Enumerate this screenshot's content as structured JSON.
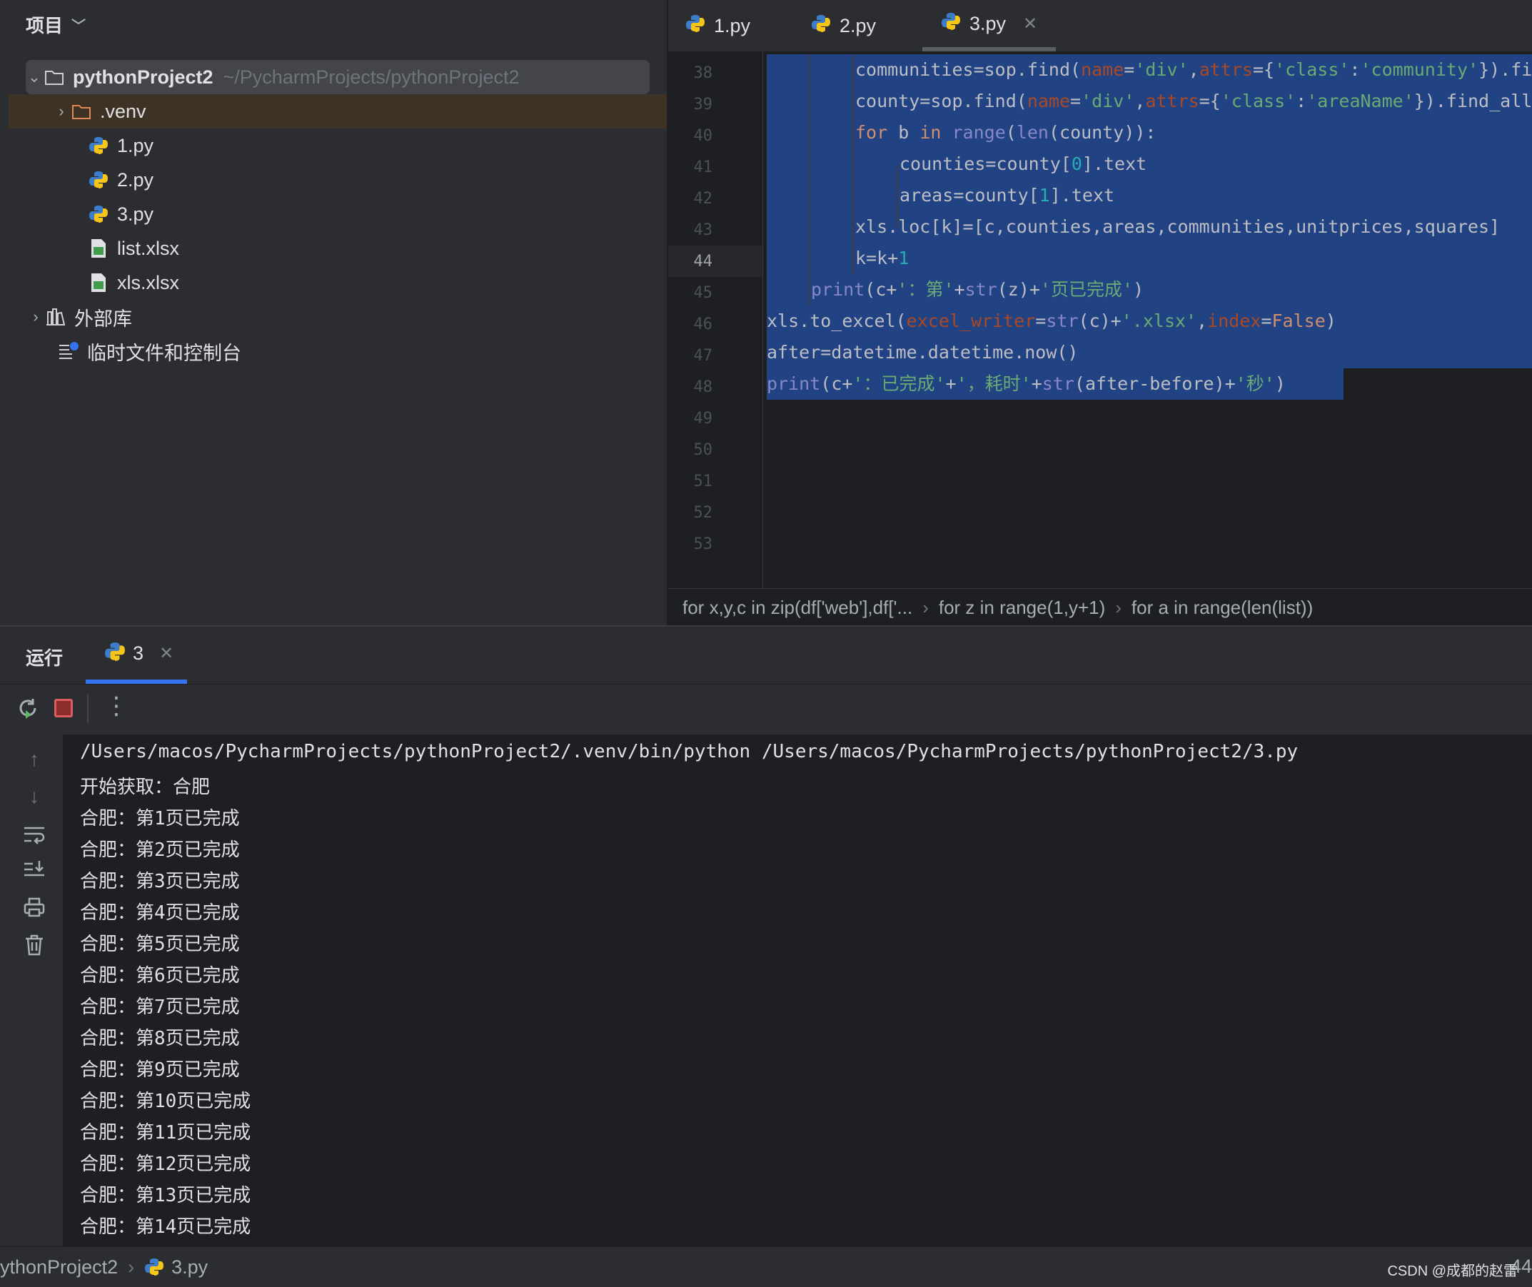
{
  "project_panel": {
    "title": "项目",
    "root": {
      "name": "pythonProject2",
      "path": "~/PycharmProjects/pythonProject2"
    },
    "items": [
      {
        "label": ".venv",
        "icon": "folder-icon"
      },
      {
        "label": "1.py",
        "icon": "python-icon"
      },
      {
        "label": "2.py",
        "icon": "python-icon"
      },
      {
        "label": "3.py",
        "icon": "python-icon"
      },
      {
        "label": "list.xlsx",
        "icon": "excel-file-icon"
      },
      {
        "label": "xls.xlsx",
        "icon": "excel-file-icon"
      },
      {
        "label": "外部库",
        "icon": "library-icon"
      },
      {
        "label": "临时文件和控制台",
        "icon": "scratches-icon"
      }
    ]
  },
  "editor": {
    "tabs": [
      {
        "label": "1.py",
        "active": false
      },
      {
        "label": "2.py",
        "active": false
      },
      {
        "label": "3.py",
        "active": true
      }
    ],
    "line_numbers": [
      "38",
      "39",
      "40",
      "41",
      "42",
      "43",
      "44",
      "45",
      "46",
      "47",
      "48",
      "49",
      "50",
      "51",
      "52",
      "53"
    ],
    "current_line": "44",
    "breadcrumbs": [
      "for x,y,c in zip(df['web'],df['...",
      "for z in range(1,y+1)",
      "for a in range(len(list))"
    ]
  },
  "run_panel": {
    "title": "运行",
    "tab_label": "3",
    "console": [
      "/Users/macos/PycharmProjects/pythonProject2/.venv/bin/python /Users/macos/PycharmProjects/pythonProject2/3.py",
      "开始获取：合肥",
      "合肥：第1页已完成",
      "合肥：第2页已完成",
      "合肥：第3页已完成",
      "合肥：第4页已完成",
      "合肥：第5页已完成",
      "合肥：第6页已完成",
      "合肥：第7页已完成",
      "合肥：第8页已完成",
      "合肥：第9页已完成",
      "合肥：第10页已完成",
      "合肥：第11页已完成",
      "合肥：第12页已完成",
      "合肥：第13页已完成",
      "合肥：第14页已完成"
    ]
  },
  "status_bar": {
    "project": "ythonProject2",
    "file": "3.py",
    "line": "44"
  },
  "watermark": "CSDN @成都的赵雷",
  "colors": {
    "selection": "#214283",
    "keyword": "#cf8e6d",
    "string": "#6aab73",
    "param": "#aa4926",
    "builtin": "#8888c6",
    "number": "#2aacb8"
  }
}
